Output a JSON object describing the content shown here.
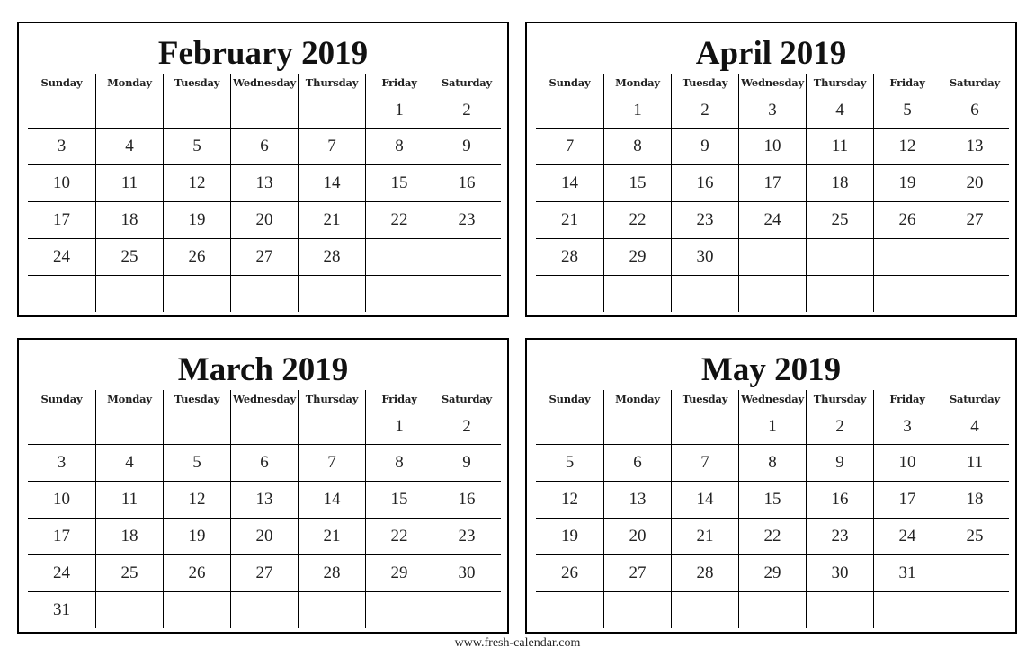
{
  "weekdays": [
    "Sunday",
    "Monday",
    "Tuesday",
    "Wednesday",
    "Thursday",
    "Friday",
    "Saturday"
  ],
  "months": [
    {
      "title": "February 2019",
      "weeks": [
        [
          "",
          "",
          "",
          "",
          "",
          "1",
          "2"
        ],
        [
          "3",
          "4",
          "5",
          "6",
          "7",
          "8",
          "9"
        ],
        [
          "10",
          "11",
          "12",
          "13",
          "14",
          "15",
          "16"
        ],
        [
          "17",
          "18",
          "19",
          "20",
          "21",
          "22",
          "23"
        ],
        [
          "24",
          "25",
          "26",
          "27",
          "28",
          "",
          ""
        ],
        [
          "",
          "",
          "",
          "",
          "",
          "",
          ""
        ]
      ]
    },
    {
      "title": "April 2019",
      "weeks": [
        [
          "",
          "1",
          "2",
          "3",
          "4",
          "5",
          "6"
        ],
        [
          "7",
          "8",
          "9",
          "10",
          "11",
          "12",
          "13"
        ],
        [
          "14",
          "15",
          "16",
          "17",
          "18",
          "19",
          "20"
        ],
        [
          "21",
          "22",
          "23",
          "24",
          "25",
          "26",
          "27"
        ],
        [
          "28",
          "29",
          "30",
          "",
          "",
          "",
          ""
        ],
        [
          "",
          "",
          "",
          "",
          "",
          "",
          ""
        ]
      ]
    },
    {
      "title": "March 2019",
      "weeks": [
        [
          "",
          "",
          "",
          "",
          "",
          "1",
          "2"
        ],
        [
          "3",
          "4",
          "5",
          "6",
          "7",
          "8",
          "9"
        ],
        [
          "10",
          "11",
          "12",
          "13",
          "14",
          "15",
          "16"
        ],
        [
          "17",
          "18",
          "19",
          "20",
          "21",
          "22",
          "23"
        ],
        [
          "24",
          "25",
          "26",
          "27",
          "28",
          "29",
          "30"
        ],
        [
          "31",
          "",
          "",
          "",
          "",
          "",
          ""
        ]
      ]
    },
    {
      "title": "May 2019",
      "weeks": [
        [
          "",
          "",
          "",
          "1",
          "2",
          "3",
          "4"
        ],
        [
          "5",
          "6",
          "7",
          "8",
          "9",
          "10",
          "11"
        ],
        [
          "12",
          "13",
          "14",
          "15",
          "16",
          "17",
          "18"
        ],
        [
          "19",
          "20",
          "21",
          "22",
          "23",
          "24",
          "25"
        ],
        [
          "26",
          "27",
          "28",
          "29",
          "30",
          "31",
          ""
        ],
        [
          "",
          "",
          "",
          "",
          "",
          "",
          ""
        ]
      ]
    }
  ],
  "footer": "www.fresh-calendar.com"
}
